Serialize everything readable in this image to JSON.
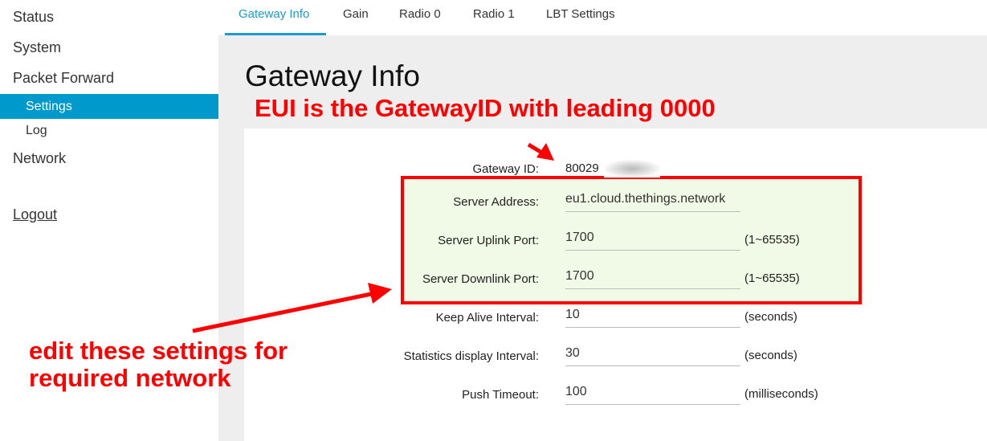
{
  "sidebar": {
    "items": [
      {
        "label": "Status"
      },
      {
        "label": "System"
      },
      {
        "label": "Packet Forward"
      },
      {
        "label": "Settings",
        "active": true
      },
      {
        "label": "Log"
      },
      {
        "label": "Network"
      }
    ],
    "logout": "Logout"
  },
  "tabs": [
    {
      "label": "Gateway Info",
      "active": true
    },
    {
      "label": "Gain"
    },
    {
      "label": "Radio 0"
    },
    {
      "label": "Radio 1"
    },
    {
      "label": "LBT Settings"
    }
  ],
  "page_title": "Gateway Info",
  "annotations": {
    "eui_note": "EUI is the GatewayID with leading 0000",
    "edit_note_line1": "edit these settings for",
    "edit_note_line2": "required network"
  },
  "form": {
    "gateway_id": {
      "label": "Gateway ID:",
      "value": "80029"
    },
    "server_address": {
      "label": "Server Address:",
      "value": "eu1.cloud.thethings.network"
    },
    "uplink_port": {
      "label": "Server Uplink Port:",
      "value": "1700",
      "unit": "(1~65535)"
    },
    "downlink_port": {
      "label": "Server Downlink Port:",
      "value": "1700",
      "unit": "(1~65535)"
    },
    "keep_alive": {
      "label": "Keep Alive Interval:",
      "value": "10",
      "unit": "(seconds)"
    },
    "stats_interval": {
      "label": "Statistics display Interval:",
      "value": "30",
      "unit": "(seconds)"
    },
    "push_timeout": {
      "label": "Push Timeout:",
      "value": "100",
      "unit": "(milliseconds)"
    }
  },
  "colors": {
    "accent": "#0099cc",
    "annotation": "#ff0000",
    "highlight": "#f0fae6"
  }
}
